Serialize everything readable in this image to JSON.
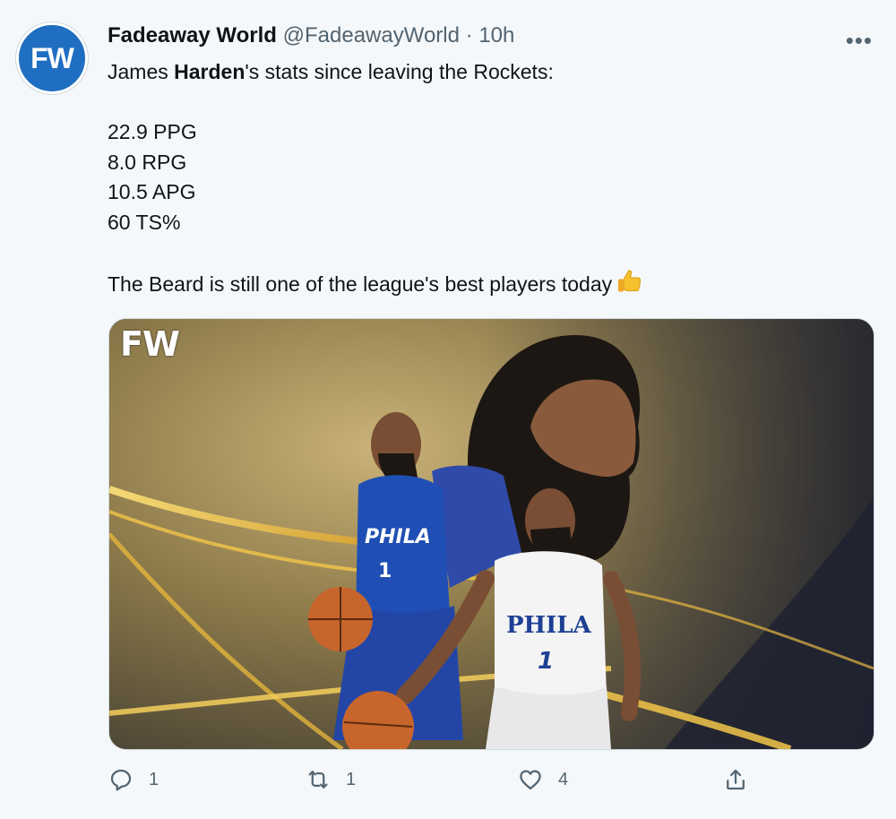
{
  "tweet": {
    "avatar_text": "FW",
    "author_name": "Fadeaway World",
    "author_handle": "@FadeawayWorld",
    "separator": "·",
    "time": "10h",
    "more": "•••",
    "body": {
      "line1_pre": "James ",
      "line1_bold": "Harden",
      "line1_post": "'s stats since leaving the Rockets:",
      "stats": [
        "22.9 PPG",
        "8.0 RPG",
        "10.5 APG",
        "60 TS%"
      ],
      "closing": "The Beard is still one of the league's best players today",
      "emoji": "thumbs-up"
    },
    "media": {
      "watermark": "FW",
      "jersey_text": "PHILA",
      "jersey_number": "1"
    },
    "actions": {
      "reply_count": "1",
      "retweet_count": "1",
      "like_count": "4"
    }
  },
  "colors": {
    "brand_blue": "#1f6ec1",
    "muted": "#536471",
    "background": "#f5f8fa"
  },
  "icons": [
    "reply-icon",
    "retweet-icon",
    "like-icon",
    "share-icon",
    "more-icon",
    "thumbs-up-emoji"
  ]
}
